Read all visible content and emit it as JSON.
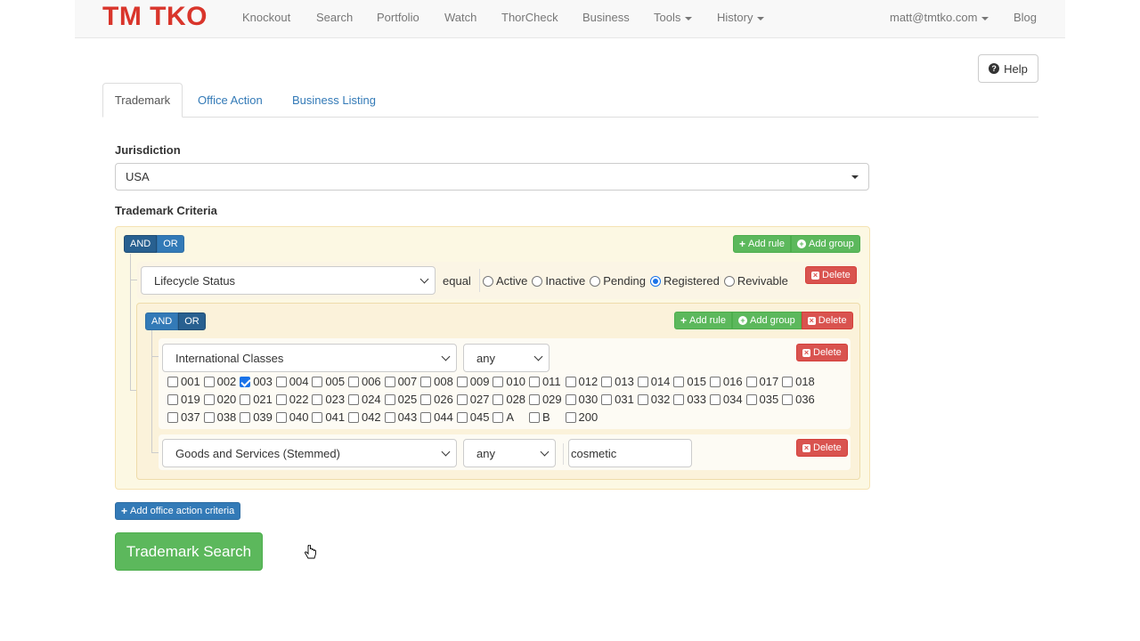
{
  "navbar": {
    "brand": "TM TKO",
    "items": [
      "Knockout",
      "Search",
      "Portfolio",
      "Watch",
      "ThorCheck",
      "Business"
    ],
    "tools": "Tools",
    "history": "History",
    "user": "matt@tmtko.com",
    "blog": "Blog"
  },
  "help": {
    "label": "Help",
    "icon": "?"
  },
  "tabs": [
    "Trademark",
    "Office Action",
    "Business Listing"
  ],
  "jurisdiction": {
    "label": "Jurisdiction",
    "value": "USA"
  },
  "criteria_label": "Trademark Criteria",
  "builder": {
    "and": "AND",
    "or": "OR",
    "add_rule": "Add rule",
    "add_group": "Add group",
    "delete": "Delete",
    "rule1": {
      "field": "Lifecycle Status",
      "operator": "equal",
      "options": [
        "Active",
        "Inactive",
        "Pending",
        "Registered",
        "Revivable"
      ],
      "selected": "Registered"
    },
    "rule2": {
      "field": "International Classes",
      "operator": "any",
      "rows": [
        [
          "001",
          "002",
          "003",
          "004",
          "005",
          "006",
          "007",
          "008",
          "009",
          "010",
          "011",
          "012",
          "013",
          "014",
          "015",
          "016",
          "017",
          "018"
        ],
        [
          "019",
          "020",
          "021",
          "022",
          "023",
          "024",
          "025",
          "026",
          "027",
          "028",
          "029",
          "030",
          "031",
          "032",
          "033",
          "034",
          "035",
          "036"
        ],
        [
          "037",
          "038",
          "039",
          "040",
          "041",
          "042",
          "043",
          "044",
          "045",
          "A",
          "B",
          "200"
        ]
      ],
      "checked": [
        "003"
      ]
    },
    "rule3": {
      "field": "Goods and Services (Stemmed)",
      "operator": "any",
      "value": "cosmetic"
    }
  },
  "add_office_action": "Add office action criteria",
  "search_button": "Trademark Search"
}
